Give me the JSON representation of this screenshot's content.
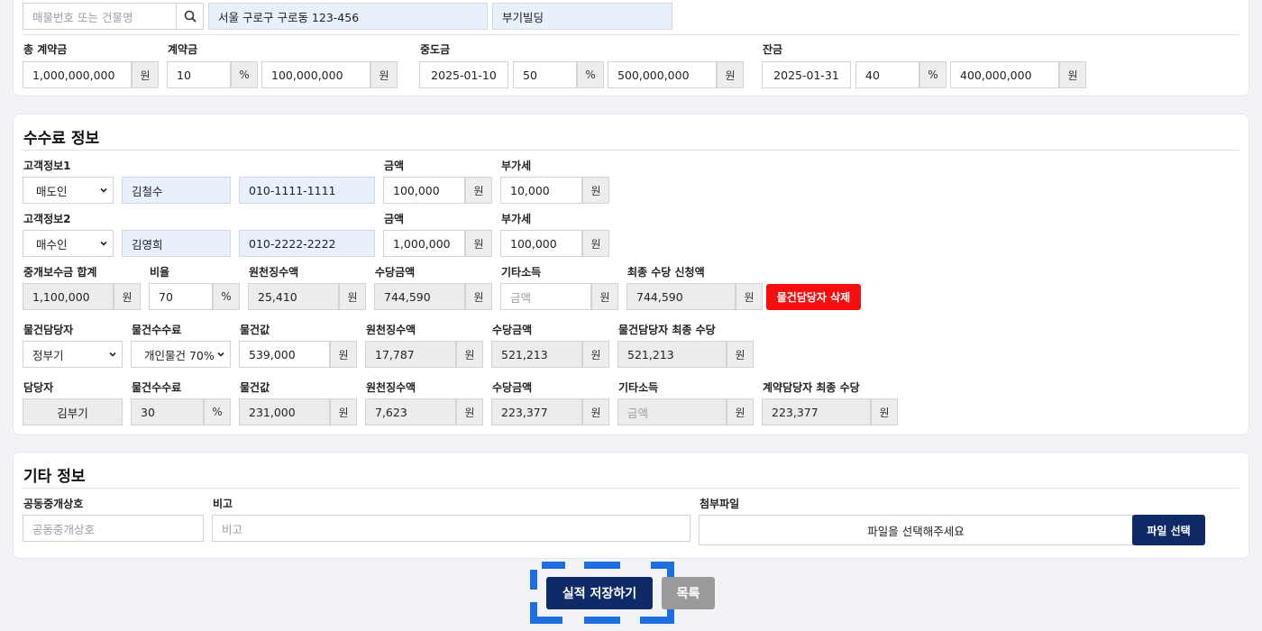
{
  "contract": {
    "search_placeholder": "매물번호 또는 건물명",
    "address": "서울 구로구 구로동 123-456",
    "building": "부기빌딩",
    "total_label": "총 계약금",
    "total_value": "1,000,000,000",
    "deposit_label": "계약금",
    "deposit_pct": "10",
    "deposit_amount": "100,000,000",
    "middle_label": "중도금",
    "middle_date": "2025-01-10",
    "middle_pct": "50",
    "middle_amount": "500,000,000",
    "balance_label": "잔금",
    "balance_date": "2025-01-31",
    "balance_pct": "40",
    "balance_amount": "400,000,000"
  },
  "units": {
    "won": "원",
    "pct": "%"
  },
  "fee": {
    "title": "수수료 정보",
    "customer1_label": "고객정보1",
    "customer1_role": "매도인",
    "customer1_name": "김철수",
    "customer1_phone": "010-1111-1111",
    "customer2_label": "고객정보2",
    "customer2_role": "매수인",
    "customer2_name": "김영희",
    "customer2_phone": "010-2222-2222",
    "amount_label": "금액",
    "vat_label": "부가세",
    "c1_amount": "100,000",
    "c1_vat": "10,000",
    "c2_amount": "1,000,000",
    "c2_vat": "100,000",
    "sum_label": "중개보수금 합계",
    "sum_value": "1,100,000",
    "ratio_label": "비율",
    "ratio_value": "70",
    "withhold_label": "원천징수액",
    "withhold_value": "25,410",
    "allowance_label": "수당금액",
    "allowance_value": "744,590",
    "other_label": "기타소득",
    "other_placeholder": "금액",
    "final_label": "최종 수당 신청액",
    "final_value": "744,590",
    "delete_button": "물건담당자 삭제",
    "prop_mgr_label": "물건담당자",
    "prop_mgr_value": "정부기",
    "prop_fee_label": "물건수수료",
    "prop_fee_value": "개인물건 70%",
    "prop_price_label": "물건값",
    "prop_price_value": "539,000",
    "prop_withhold_value": "17,787",
    "prop_allowance_value": "521,213",
    "prop_final_label": "물건담당자 최종 수당",
    "prop_final_value": "521,213",
    "mgr_label": "담당자",
    "mgr_value": "김부기",
    "mgr_fee_value": "30",
    "mgr_price_value": "231,000",
    "mgr_withhold_value": "7,623",
    "mgr_allowance_value": "223,377",
    "mgr_final_label": "계약담당자 최종 수당",
    "mgr_final_value": "223,377"
  },
  "other": {
    "title": "기타 정보",
    "joint_label": "공동중개상호",
    "joint_placeholder": "공동중개상호",
    "memo_label": "비고",
    "memo_placeholder": "비고",
    "file_label": "첨부파일",
    "file_placeholder": "파일을 선택해주세요",
    "file_button": "파일 선택"
  },
  "actions": {
    "save_button": "실적 저장하기",
    "list_button": "목록"
  },
  "colors": {
    "navy": "#0f2a66",
    "red": "#f70d0d",
    "highlight": "#1f6fe0"
  }
}
